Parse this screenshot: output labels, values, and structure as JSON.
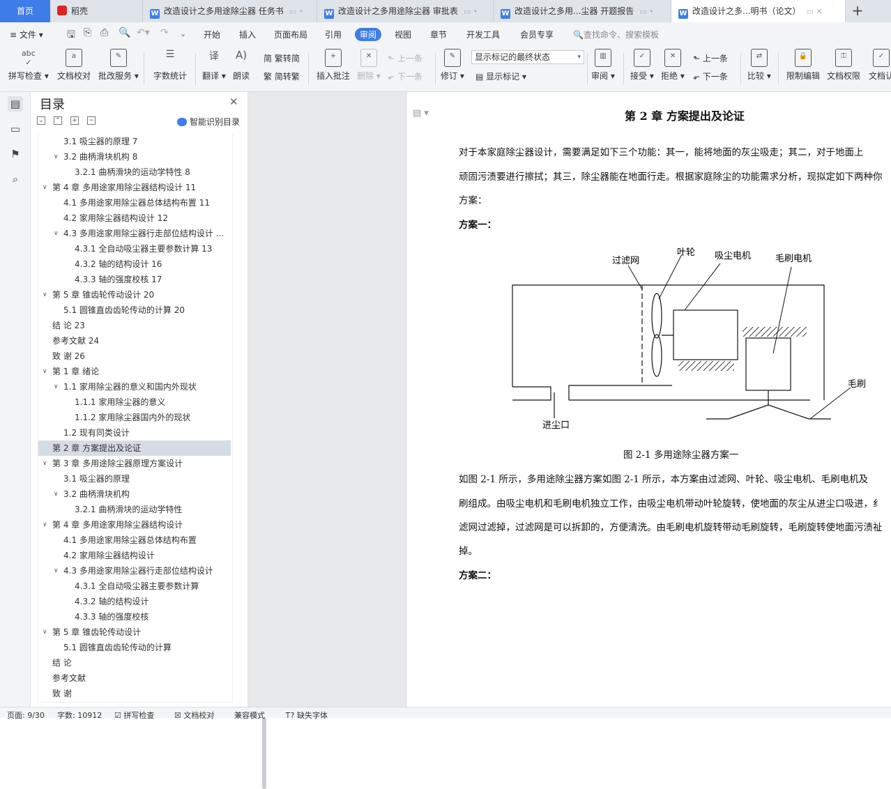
{
  "tabs": {
    "home": "首页",
    "items": [
      {
        "label": "稻壳",
        "icon": "daoke-icon"
      },
      {
        "label": "改造设计之多用途除尘器 任务书",
        "icon": "wps-writer-icon"
      },
      {
        "label": "改造设计之多用途除尘器 审批表",
        "icon": "wps-writer-icon"
      },
      {
        "label": "改造设计之多用...尘器 开题报告",
        "icon": "wps-writer-icon"
      },
      {
        "label": "改造设计之多...明书（论文）",
        "icon": "wps-writer-icon"
      }
    ],
    "add": "+"
  },
  "menubar": {
    "file": "文件",
    "items": [
      "开始",
      "插入",
      "页面布局",
      "引用",
      "审阅",
      "视图",
      "章节",
      "开发工具",
      "会员专享"
    ],
    "active": "审阅",
    "search_placeholder": "查找命令、搜索模板"
  },
  "ribbon": {
    "spell": "拼写检查",
    "proof": "文档校对",
    "annot": "批改服务",
    "wordcount": "字数统计",
    "translate": "翻译",
    "read": "朗读",
    "to_trad": "繁转简",
    "to_simp": "简转繁",
    "insert_comment": "插入批注",
    "delete": "删除",
    "prev_comment": "上一条",
    "next_comment": "下一条",
    "revise": "修订",
    "display_state": "显示标记的最终状态",
    "show_marks": "显示标记",
    "review_pane": "审阅",
    "accept": "接受",
    "reject": "拒绝",
    "prev_change": "上一条",
    "next_change": "下一条",
    "compare": "比较",
    "restrict": "限制编辑",
    "doc_rights": "文档权限",
    "doc_cert": "文档认"
  },
  "toc": {
    "title": "目录",
    "smart_label": "智能识别目录",
    "rows": [
      {
        "text": "3.1 吸尘器的原理  7",
        "level": 2,
        "arrow": ""
      },
      {
        "text": "3.2  曲柄滑块机构  8",
        "level": 2,
        "arrow": "v"
      },
      {
        "text": "3.2.1 曲柄滑块的运动学特性  8",
        "level": 3,
        "arrow": ""
      },
      {
        "text": "第 4 章  多用途家用除尘器结构设计  11",
        "level": 1,
        "arrow": "v"
      },
      {
        "text": "4.1  多用途家用除尘器总体结构布置  11",
        "level": 2,
        "arrow": ""
      },
      {
        "text": "4.2 家用除尘器结构设计  12",
        "level": 2,
        "arrow": ""
      },
      {
        "text": "4.3 多用途家用除尘器行走部位结构设计  ...",
        "level": 2,
        "arrow": "v"
      },
      {
        "text": "4.3.1 全自动吸尘器主要参数计算  13",
        "level": 3,
        "arrow": ""
      },
      {
        "text": "4.3.2 轴的结构设计  16",
        "level": 3,
        "arrow": ""
      },
      {
        "text": "4.3.3 轴的强度校核  17",
        "level": 3,
        "arrow": ""
      },
      {
        "text": "第 5 章  锥齿轮传动设计  20",
        "level": 1,
        "arrow": "v"
      },
      {
        "text": "5.1 圆锥直齿齿轮传动的计算  20",
        "level": 2,
        "arrow": ""
      },
      {
        "text": "结    论  23",
        "level": 1,
        "arrow": ""
      },
      {
        "text": "参考文献  24",
        "level": 1,
        "arrow": ""
      },
      {
        "text": "致    谢  26",
        "level": 1,
        "arrow": ""
      },
      {
        "text": "第 1 章  绪论",
        "level": 1,
        "arrow": "v"
      },
      {
        "text": "1.1 家用除尘器的意义和国内外现状",
        "level": 2,
        "arrow": "v"
      },
      {
        "text": "1.1.1 家用除尘器的意义",
        "level": 3,
        "arrow": ""
      },
      {
        "text": "1.1.2 家用除尘器国内外的现状",
        "level": 3,
        "arrow": ""
      },
      {
        "text": "1.2 现有同类设计",
        "level": 2,
        "arrow": ""
      },
      {
        "text": "第 2 章  方案提出及论证",
        "level": 1,
        "arrow": "",
        "selected": true
      },
      {
        "text": "第 3 章  多用途除尘器原理方案设计",
        "level": 1,
        "arrow": "v"
      },
      {
        "text": "3.1 吸尘器的原理",
        "level": 2,
        "arrow": ""
      },
      {
        "text": "3.2  曲柄滑块机构",
        "level": 2,
        "arrow": "v"
      },
      {
        "text": "3.2.1 曲柄滑块的运动学特性",
        "level": 3,
        "arrow": ""
      },
      {
        "text": "第 4 章  多用途家用除尘器结构设计",
        "level": 1,
        "arrow": "v"
      },
      {
        "text": "4.1  多用途家用除尘器总体结构布置",
        "level": 2,
        "arrow": ""
      },
      {
        "text": "4.2 家用除尘器结构设计",
        "level": 2,
        "arrow": ""
      },
      {
        "text": "4.3 多用途家用除尘器行走部位结构设计",
        "level": 2,
        "arrow": "v"
      },
      {
        "text": "4.3.1 全自动吸尘器主要参数计算",
        "level": 3,
        "arrow": ""
      },
      {
        "text": "4.3.2 轴的结构设计",
        "level": 3,
        "arrow": ""
      },
      {
        "text": "4.3.3 轴的强度校核",
        "level": 3,
        "arrow": ""
      },
      {
        "text": "第 5 章  锥齿轮传动设计",
        "level": 1,
        "arrow": "v"
      },
      {
        "text": "5.1 圆锥直齿齿轮传动的计算",
        "level": 2,
        "arrow": ""
      },
      {
        "text": "结    论",
        "level": 1,
        "arrow": ""
      },
      {
        "text": "参考文献",
        "level": 1,
        "arrow": ""
      },
      {
        "text": "致    谢",
        "level": 1,
        "arrow": ""
      }
    ]
  },
  "document": {
    "heading": "第 2 章  方案提出及论证",
    "para1": [
      "      对于本家庭除尘器设计，需要满足如下三个功能：其一，能将地面的灰尘吸走；其二，对于地面上",
      "顽固污渍要进行擦拭；其三，除尘器能在地面行走。根据家庭除尘的功能需求分析，现拟定如下两种你",
      "方案："
    ],
    "scheme1": "方案一：",
    "diagram_labels": {
      "filter": "过滤网",
      "impeller": "叶轮",
      "suction_motor": "吸尘电机",
      "brush_motor": "毛刷电机",
      "brush": "毛刷",
      "inlet": "进尘口"
    },
    "caption": "图 2-1  多用途除尘器方案一",
    "para2": [
      "       如图 2-1 所示，多用途除尘器方案如图 2-1 所示，本方案由过滤网、叶轮、吸尘电机、毛刷电机及",
      "刷组成。由吸尘电机和毛刷电机独立工作，由吸尘电机带动叶轮旋转，使地面的灰尘从进尘口吸进，纟",
      "滤网过滤掉，过滤网是可以拆卸的，方便清洗。由毛刷电机旋转带动毛刷旋转，毛刷旋转使地面污渍祉",
      "掉。"
    ],
    "scheme2": "方案二："
  },
  "status": {
    "page": "页面: 9/30",
    "words": "字数: 10912",
    "spell": "拼写检查",
    "proof": "文档校对",
    "compat": "兼容模式",
    "missing_font": "缺失字体"
  },
  "colors": {
    "accent": "#3f7de8",
    "ribbon_bg": "#f3f4f6",
    "toc_selected": "#d5dce6"
  }
}
